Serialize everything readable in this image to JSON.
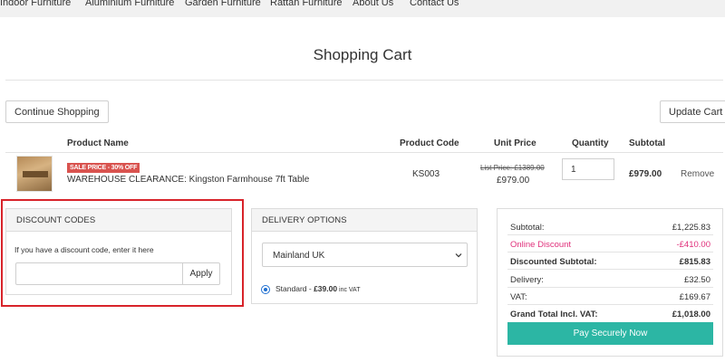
{
  "nav": {
    "items": [
      "Indoor Furniture",
      "Aluminium Furniture",
      "Garden Furniture",
      "Rattan Furniture",
      "About Us",
      "Contact Us"
    ]
  },
  "page": {
    "title": "Shopping Cart"
  },
  "actions": {
    "continue_label": "Continue Shopping",
    "update_label": "Update Cart"
  },
  "table": {
    "headers": {
      "name": "Product Name",
      "code": "Product Code",
      "unit_price": "Unit Price",
      "quantity": "Quantity",
      "subtotal": "Subtotal"
    }
  },
  "item": {
    "badge": "SALE PRICE - 30% OFF",
    "name": "WAREHOUSE CLEARANCE: Kingston Farmhouse 7ft Table",
    "code": "KS003",
    "list_price": "List Price: £1389.00",
    "unit_price": "£979.00",
    "quantity": "1",
    "subtotal": "£979.00",
    "remove_label": "Remove"
  },
  "discount": {
    "heading": "DISCOUNT CODES",
    "hint": "If you have a discount code, enter it here",
    "value": "",
    "apply_label": "Apply"
  },
  "delivery": {
    "heading": "DELIVERY OPTIONS",
    "region": "Mainland UK",
    "option_label": "Standard - ",
    "option_price": "£39.00",
    "option_vat": " inc VAT"
  },
  "summary": {
    "subtotal_label": "Subtotal:",
    "subtotal": "£1,225.83",
    "discount_label": "Online Discount",
    "discount": "-£410.00",
    "disc_subtotal_label": "Discounted Subtotal:",
    "disc_subtotal": "£815.83",
    "delivery_label": "Delivery:",
    "delivery": "£32.50",
    "vat_label": "VAT:",
    "vat": "£169.67",
    "grand_label": "Grand Total Incl. VAT:",
    "grand": "£1,018.00",
    "pay_label": "Pay Securely Now"
  },
  "colors": {
    "pay_button": "#2cb6a4",
    "discount_text": "#e0307b",
    "sale_badge": "#d9534f",
    "highlight": "#d8232a",
    "radio": "#1f6fd1"
  }
}
